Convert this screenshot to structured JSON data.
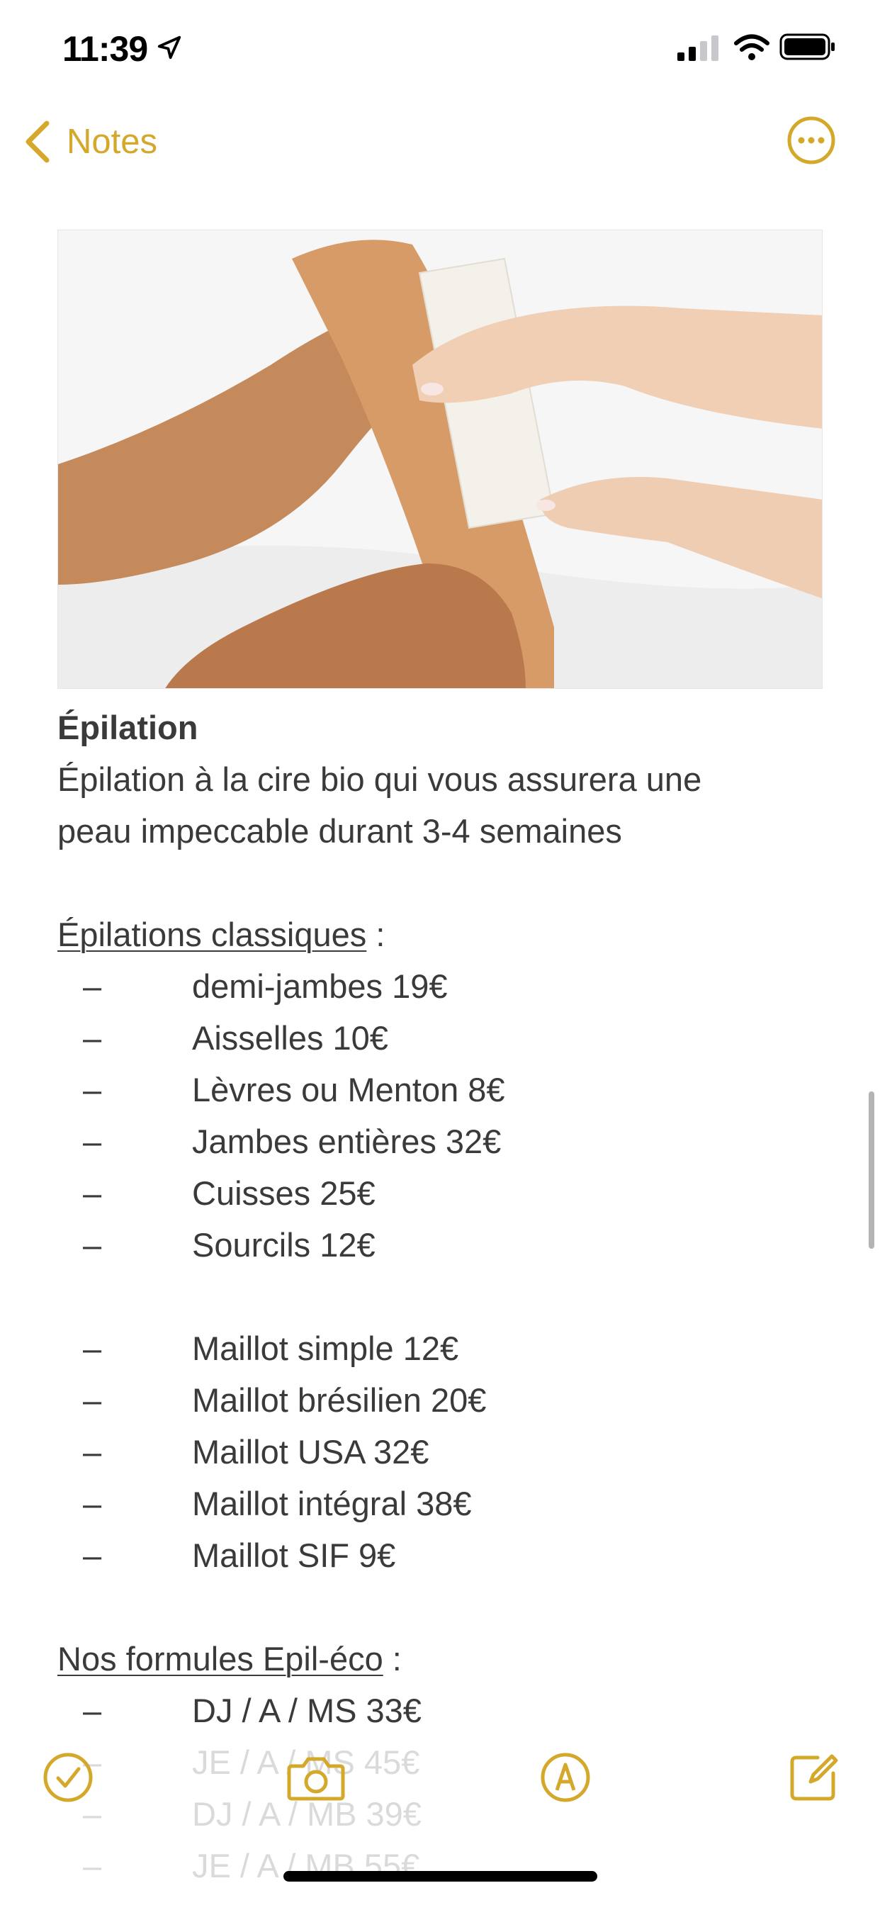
{
  "status_bar": {
    "time": "11:39"
  },
  "nav": {
    "back_label": "Notes"
  },
  "note": {
    "title": "Épilation",
    "intro_line1": "Épilation à la cire bio qui vous assurera une",
    "intro_line2": "peau impeccable durant 3-4 semaines",
    "section1_heading": "Épilations classiques",
    "section1_colon": " :",
    "dash": "–",
    "list1": [
      "demi-jambes 19€",
      "Aisselles 10€",
      "Lèvres ou Menton 8€",
      "Jambes entières 32€",
      "Cuisses 25€",
      "Sourcils 12€"
    ],
    "list2": [
      "Maillot simple 12€",
      "Maillot brésilien 20€",
      "Maillot USA 32€",
      "Maillot intégral 38€",
      "Maillot SIF 9€"
    ],
    "section2_heading": "Nos formules Epil-éco",
    "section2_colon": " :",
    "list3": [
      "DJ / A / MS 33€"
    ],
    "faded_rows": [
      "JE / A / MS 45€",
      "DJ / A / MB 39€",
      "JE / A / MB 55€"
    ]
  },
  "colors": {
    "accent": "#d4a82a",
    "text": "#3a3a3c"
  },
  "icons": {
    "back": "chevron-left-icon",
    "more": "ellipsis-circle-icon",
    "checklist": "checkmark-circle-icon",
    "camera": "camera-icon",
    "markup": "pen-circle-icon",
    "compose": "compose-icon"
  }
}
